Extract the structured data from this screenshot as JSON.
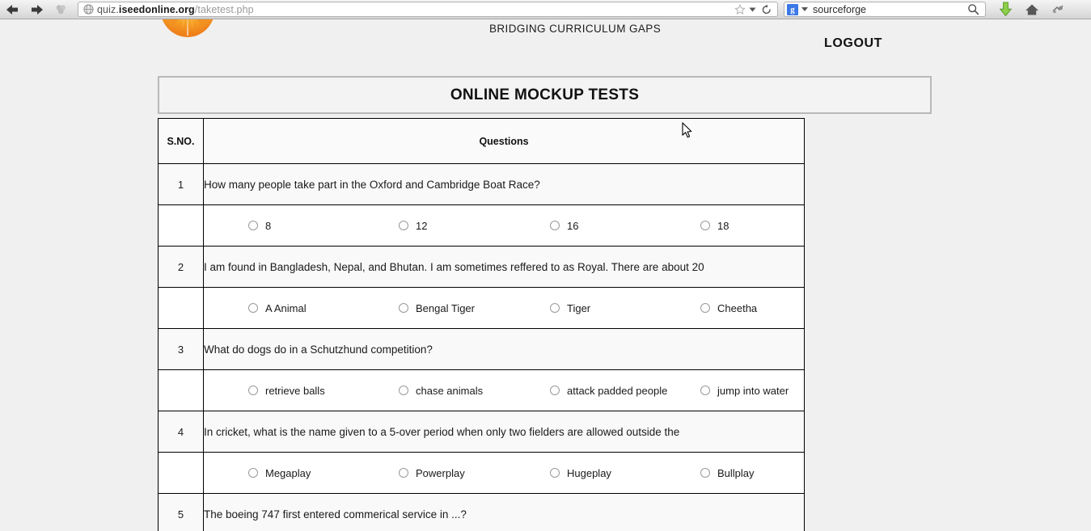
{
  "browser": {
    "back_icon": "back-arrow-icon",
    "forward_icon": "forward-arrow-icon",
    "stop_icon": "stop-icon",
    "url_prefix": "quiz.",
    "url_domain": "iseedonline.org",
    "url_path": "/taketest.php",
    "url_full": "quiz.iseedonline.org/taketest.php",
    "bookmark_icon": "star-icon",
    "bookmark_dropdown_icon": "chevron-down-icon",
    "reload_icon": "reload-icon",
    "search_engine_icon": "google-icon",
    "search_engine_letter": "g",
    "search_dropdown_icon": "chevron-down-icon",
    "search_value": "sourceforge",
    "search_submit_icon": "search-icon",
    "download_icon": "download-arrow-icon",
    "home_icon": "home-icon",
    "addon_icon": "addon-icon"
  },
  "site": {
    "logo_icon": "sunburst-logo-icon",
    "tagline": "BRIDGING CURRICULUM GAPS",
    "logout_label": "LOGOUT"
  },
  "main": {
    "title": "ONLINE MOCKUP TESTS",
    "columns": {
      "sno": "S.NO.",
      "questions": "Questions"
    },
    "questions": [
      {
        "no": "1",
        "text": "How many people take part in the Oxford and Cambridge Boat Race?",
        "options": [
          "8",
          "12",
          "16",
          "18"
        ]
      },
      {
        "no": "2",
        "text": "I am found in Bangladesh, Nepal, and Bhutan. I am sometimes reffered to as Royal. There are about 20",
        "options": [
          "A Animal",
          "Bengal Tiger",
          "Tiger",
          "Cheetha"
        ]
      },
      {
        "no": "3",
        "text": "What do dogs do in a Schutzhund competition?",
        "options": [
          "retrieve balls",
          "chase animals",
          "attack padded people",
          "jump into water"
        ]
      },
      {
        "no": "4",
        "text": "In cricket, what is the name given to a 5-over period when only two fielders are allowed outside the",
        "options": [
          "Megaplay",
          "Powerplay",
          "Hugeplay",
          "Bullplay"
        ]
      },
      {
        "no": "5",
        "text": "The boeing 747 first entered commerical service in ...?",
        "options": []
      }
    ]
  },
  "cursor": {
    "icon": "mouse-pointer-icon"
  },
  "colors": {
    "page_background": "#f0f0f0",
    "question_row": "#f9f9f9",
    "answer_row": "#ffffff",
    "table_border": "#000000",
    "title_box_border": "#b9b9b9",
    "download_accent": "#7bc043",
    "logo_accent": "#f59c20"
  }
}
